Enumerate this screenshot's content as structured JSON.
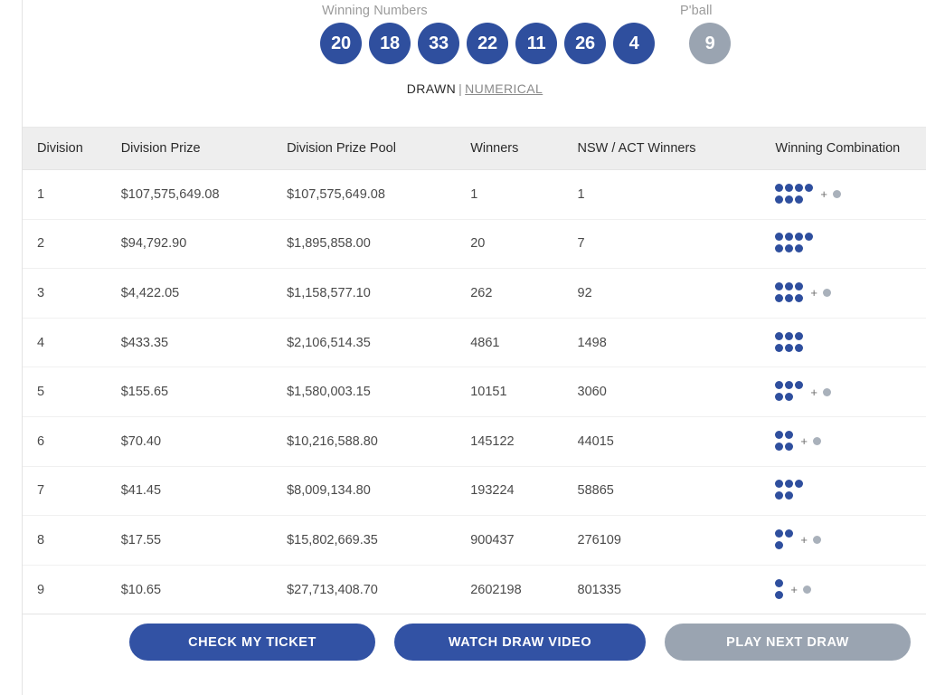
{
  "draw": {
    "winning_numbers_label": "Winning Numbers",
    "powerball_label": "P'ball",
    "numbers": [
      "20",
      "18",
      "33",
      "22",
      "11",
      "26",
      "4"
    ],
    "powerball": "9",
    "order_drawn_label": "DRAWN",
    "order_separator": "|",
    "order_numerical_label": "NUMERICAL",
    "ball_color": "#2f4f9e",
    "powerball_color": "#9aa4b1"
  },
  "table": {
    "headers": {
      "division": "Division",
      "division_prize": "Division Prize",
      "division_prize_pool": "Division Prize Pool",
      "winners": "Winners",
      "nsw_act_winners": "NSW / ACT Winners",
      "winning_combination": "Winning Combination"
    },
    "rows": [
      {
        "division": "1",
        "division_prize": "$107,575,649.08",
        "division_prize_pool": "$107,575,649.08",
        "winners": "1",
        "nsw_act_winners": "1",
        "combination": {
          "main_dots": 7,
          "powerball": true
        }
      },
      {
        "division": "2",
        "division_prize": "$94,792.90",
        "division_prize_pool": "$1,895,858.00",
        "winners": "20",
        "nsw_act_winners": "7",
        "combination": {
          "main_dots": 7,
          "powerball": false
        }
      },
      {
        "division": "3",
        "division_prize": "$4,422.05",
        "division_prize_pool": "$1,158,577.10",
        "winners": "262",
        "nsw_act_winners": "92",
        "combination": {
          "main_dots": 6,
          "powerball": true
        }
      },
      {
        "division": "4",
        "division_prize": "$433.35",
        "division_prize_pool": "$2,106,514.35",
        "winners": "4861",
        "nsw_act_winners": "1498",
        "combination": {
          "main_dots": 6,
          "powerball": false
        }
      },
      {
        "division": "5",
        "division_prize": "$155.65",
        "division_prize_pool": "$1,580,003.15",
        "winners": "10151",
        "nsw_act_winners": "3060",
        "combination": {
          "main_dots": 5,
          "powerball": true
        }
      },
      {
        "division": "6",
        "division_prize": "$70.40",
        "division_prize_pool": "$10,216,588.80",
        "winners": "145122",
        "nsw_act_winners": "44015",
        "combination": {
          "main_dots": 4,
          "powerball": true
        }
      },
      {
        "division": "7",
        "division_prize": "$41.45",
        "division_prize_pool": "$8,009,134.80",
        "winners": "193224",
        "nsw_act_winners": "58865",
        "combination": {
          "main_dots": 5,
          "powerball": false
        }
      },
      {
        "division": "8",
        "division_prize": "$17.55",
        "division_prize_pool": "$15,802,669.35",
        "winners": "900437",
        "nsw_act_winners": "276109",
        "combination": {
          "main_dots": 3,
          "powerball": true
        }
      },
      {
        "division": "9",
        "division_prize": "$10.65",
        "division_prize_pool": "$27,713,408.70",
        "winners": "2602198",
        "nsw_act_winners": "801335",
        "combination": {
          "main_dots": 2,
          "powerball": true
        }
      }
    ]
  },
  "actions": {
    "check_my_ticket": "CHECK MY TICKET",
    "watch_draw_video": "WATCH DRAW VIDEO",
    "play_next_draw": "PLAY NEXT DRAW"
  }
}
